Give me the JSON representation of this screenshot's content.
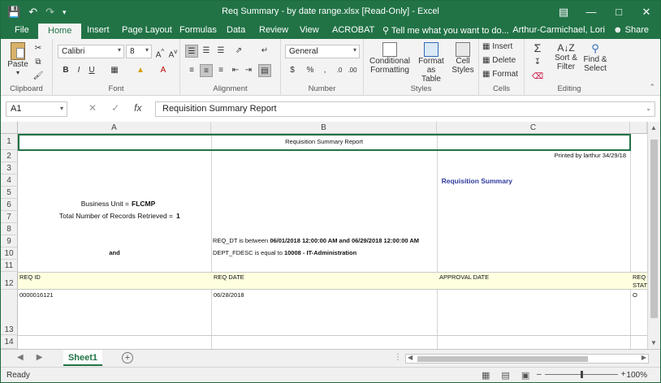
{
  "window": {
    "title": "Req Summary - by date range.xlsx  [Read-Only]  -  Excel",
    "user": "Arthur-Carmichael, Lori",
    "share": "Share",
    "tell_me": "Tell me what you want to do..."
  },
  "tabs": [
    "File",
    "Home",
    "Insert",
    "Page Layout",
    "Formulas",
    "Data",
    "Review",
    "View",
    "ACROBAT"
  ],
  "ribbon": {
    "paste": "Paste",
    "font_name": "Calibri",
    "font_size": "8",
    "number_format": "General",
    "conditional": [
      "Conditional",
      "Formatting"
    ],
    "format_table": [
      "Format as",
      "Table"
    ],
    "cell_styles": [
      "Cell",
      "Styles"
    ],
    "insert": "Insert",
    "delete": "Delete",
    "format": "Format",
    "sort": [
      "Sort &",
      "Filter"
    ],
    "find": [
      "Find &",
      "Select"
    ],
    "groups": {
      "clipboard": "Clipboard",
      "font": "Font",
      "alignment": "Alignment",
      "number": "Number",
      "styles": "Styles",
      "cells": "Cells",
      "editing": "Editing"
    }
  },
  "formula_bar": {
    "name_box": "A1",
    "fx": "fx",
    "content": "Requisition Summary Report"
  },
  "columns": [
    "A",
    "B",
    "C"
  ],
  "rows": [
    "1",
    "2",
    "3",
    "4",
    "5",
    "6",
    "7",
    "8",
    "9",
    "10",
    "11",
    "12",
    "13",
    "14"
  ],
  "cells": {
    "r1_title": "Requisition Summary Report",
    "r2_printed": "Printed by larthur 34/29/18",
    "r4_summary": "Requisition Summary",
    "r6_bu_label": "Business Unit =",
    "r6_bu_value": "FLCMP",
    "r7_total_label": "Total Number of Records Retrieved =",
    "r7_total_value": "1",
    "r9_crit_prefix": "REQ_DT is between",
    "r9_crit_value": "06/01/2018 12:00:00 AM and 06/29/2018 12:00:00 AM",
    "r10_and": "and",
    "r10_crit_prefix": "DEPT_FDESC is equal to",
    "r10_crit_value": "10008 - IT-Administration",
    "h_req_id": "REQ ID",
    "h_req_date": "REQ DATE",
    "h_approval": "APPROVAL DATE",
    "h_req_stat_1": "REQ",
    "h_req_stat_2": "STAT",
    "d_req_id": "0000016121",
    "d_req_date": "06/28/2018",
    "d_stat": "O"
  },
  "sheet": {
    "name": "Sheet1",
    "add": "+"
  },
  "status": {
    "ready": "Ready",
    "zoom": "100%"
  },
  "colors": {
    "brand": "#217346",
    "header_fill": "#ffffe0",
    "summary_blue": "#2e3b9e"
  }
}
